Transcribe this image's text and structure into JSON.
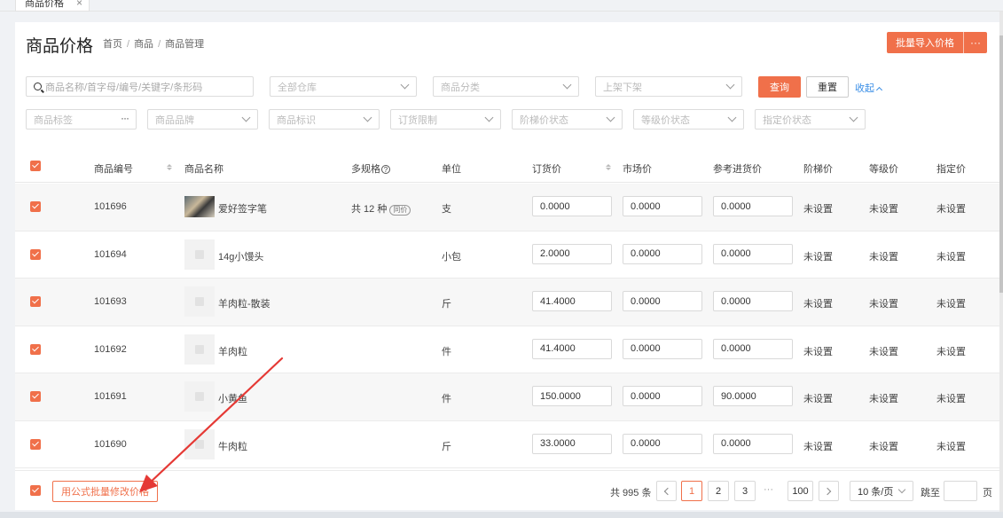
{
  "tab": {
    "label": "商品价格",
    "close": "×"
  },
  "page": {
    "title": "商品价格"
  },
  "breadcrumb": [
    "首页",
    "商品",
    "商品管理"
  ],
  "breadcrumb_sep": "/",
  "header": {
    "import_label": "批量导入价格",
    "more_label": "···"
  },
  "filters": {
    "search_placeholder": "商品名称/首字母/编号/关键字/条形码",
    "warehouse": "全部仓库",
    "category": "商品分类",
    "shelf": "上架下架",
    "tag": "商品标签",
    "brand": "商品品牌",
    "mark": "商品标识",
    "order_limit": "订货限制",
    "tier_status": "阶梯价状态",
    "grade_status": "等级价状态",
    "assigned_status": "指定价状态",
    "query_label": "查询",
    "reset_label": "重置",
    "collapse_label": "收起"
  },
  "columns": {
    "code": "商品编号",
    "name": "商品名称",
    "spec": "多规格",
    "unit": "单位",
    "order_price": "订货价",
    "market_price": "市场价",
    "ref_price": "参考进货价",
    "tier_price": "阶梯价",
    "grade_price": "等级价",
    "assigned_price": "指定价"
  },
  "rows": [
    {
      "code": "101696",
      "name": "爱好签字笔",
      "spec": "共 12 种",
      "spec_tag": "同价",
      "unit": "支",
      "order_price": "0.0000",
      "market_price": "0.0000",
      "ref_price": "0.0000",
      "tier": "未设置",
      "grade": "未设置",
      "assigned": "未设置"
    },
    {
      "code": "101694",
      "name": "14g小馒头",
      "spec": "",
      "spec_tag": "",
      "unit": "小包",
      "order_price": "2.0000",
      "market_price": "0.0000",
      "ref_price": "0.0000",
      "tier": "未设置",
      "grade": "未设置",
      "assigned": "未设置"
    },
    {
      "code": "101693",
      "name": "羊肉粒-散装",
      "spec": "",
      "spec_tag": "",
      "unit": "斤",
      "order_price": "41.4000",
      "market_price": "0.0000",
      "ref_price": "0.0000",
      "tier": "未设置",
      "grade": "未设置",
      "assigned": "未设置"
    },
    {
      "code": "101692",
      "name": "羊肉粒",
      "spec": "",
      "spec_tag": "",
      "unit": "件",
      "order_price": "41.4000",
      "market_price": "0.0000",
      "ref_price": "0.0000",
      "tier": "未设置",
      "grade": "未设置",
      "assigned": "未设置"
    },
    {
      "code": "101691",
      "name": "小黄鱼",
      "spec": "",
      "spec_tag": "",
      "unit": "件",
      "order_price": "150.0000",
      "market_price": "0.0000",
      "ref_price": "90.0000",
      "tier": "未设置",
      "grade": "未设置",
      "assigned": "未设置"
    },
    {
      "code": "101690",
      "name": "牛肉粒",
      "spec": "",
      "spec_tag": "",
      "unit": "斤",
      "order_price": "33.0000",
      "market_price": "0.0000",
      "ref_price": "0.0000",
      "tier": "未设置",
      "grade": "未设置",
      "assigned": "未设置"
    }
  ],
  "footer": {
    "formula_label": "用公式批量修改价格",
    "total": "共 995 条",
    "pages": [
      "1",
      "2",
      "3"
    ],
    "ellipsis": "···",
    "last_page": "100",
    "page_size": "10 条/页",
    "jump_label": "跳至",
    "page_unit": "页"
  },
  "colors": {
    "accent": "#f0704a",
    "link": "#3a8ee6"
  }
}
